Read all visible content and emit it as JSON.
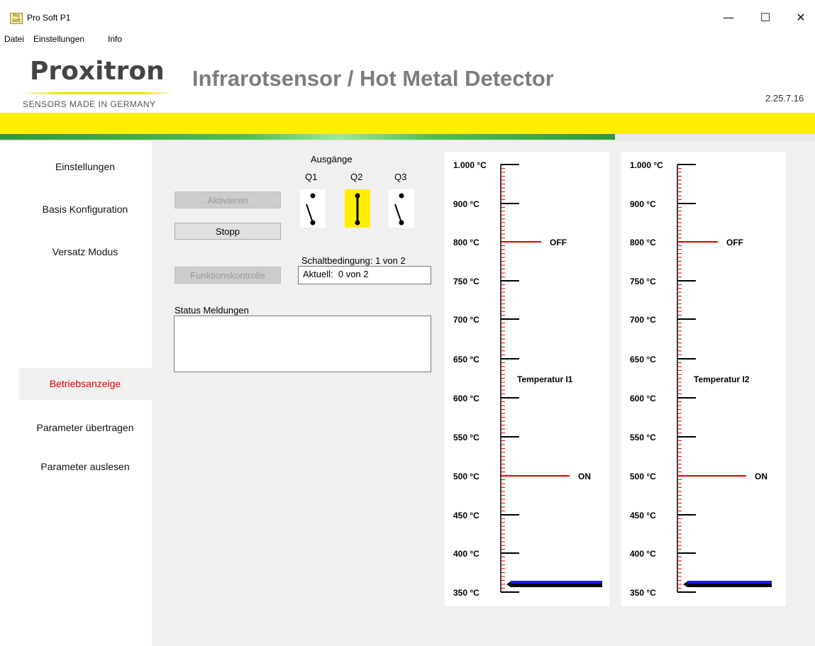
{
  "window": {
    "title": "Pro Soft P1",
    "icon_text": "Pro Soft",
    "minimize": "—",
    "maximize": "☐",
    "close": "✕"
  },
  "menu": [
    "Datei",
    "Einstellungen",
    "Info"
  ],
  "header": {
    "logo": "Proxitron",
    "tagline": "SENSORS MADE IN GERMANY",
    "title": "Infrarotsensor / Hot Metal Detector",
    "version": "2.25.7.16",
    "progress_fraction": 0.755
  },
  "sidebar": {
    "items": [
      {
        "label": "Einstellungen"
      },
      {
        "label": "Basis Konfiguration"
      },
      {
        "label": "Versatz Modus"
      },
      {
        "label": "Betriebsanzeige"
      },
      {
        "label": "Parameter übertragen"
      },
      {
        "label": "Parameter auslesen"
      }
    ],
    "active": "Betriebsanzeige"
  },
  "controls": {
    "activate_label": "Aktivieren",
    "stop_label": "Stopp",
    "function_check_label": "Funktionskontrolle",
    "outputs_label": "Ausgänge",
    "outputs": [
      {
        "name": "Q1",
        "state": "open"
      },
      {
        "name": "Q2",
        "state": "closed"
      },
      {
        "name": "Q3",
        "state": "open"
      }
    ],
    "condition_label": "Schaltbedingung: 1 von 2",
    "current_value": "Aktuell:  0 von 2",
    "status_label": "Status Meldungen",
    "status_text": ""
  },
  "gauges": [
    {
      "name": "Temperatur I1",
      "ticks": [
        "1.000 °C",
        "900 °C",
        "800 °C",
        "750 °C",
        "700 °C",
        "650 °C",
        "600 °C",
        "550 °C",
        "500 °C",
        "450 °C",
        "400 °C",
        "350 °C"
      ],
      "off_label": "OFF",
      "off_value": 800,
      "on_label": "ON",
      "on_value": 500,
      "current_value": 360
    },
    {
      "name": "Temperatur I2",
      "ticks": [
        "1.000 °C",
        "900 °C",
        "800 °C",
        "750 °C",
        "700 °C",
        "650 °C",
        "600 °C",
        "550 °C",
        "500 °C",
        "450 °C",
        "400 °C",
        "350 °C"
      ],
      "off_label": "OFF",
      "off_value": 800,
      "on_label": "ON",
      "on_value": 500,
      "current_value": 360
    }
  ],
  "colors": {
    "accent_yellow": "#ffee00",
    "progress_green": "#2e9a3a",
    "threshold_red": "#e00000",
    "indicator_blue": "#1a1aff",
    "active_item_red": "#e00000",
    "switch_closed_bg": "#ffee00"
  }
}
